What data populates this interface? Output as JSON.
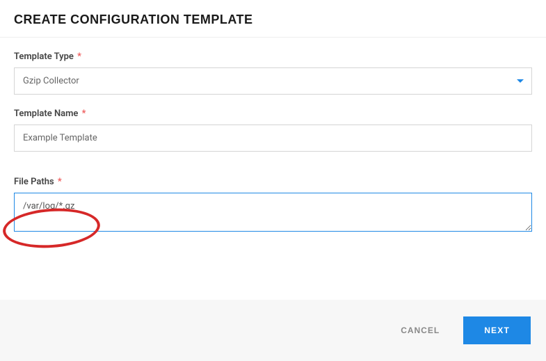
{
  "header": {
    "title": "CREATE CONFIGURATION TEMPLATE"
  },
  "form": {
    "template_type": {
      "label": "Template Type",
      "required_mark": "*",
      "value": "Gzip Collector"
    },
    "template_name": {
      "label": "Template Name",
      "required_mark": "*",
      "value": "Example Template"
    },
    "file_paths": {
      "label": "File Paths",
      "required_mark": "*",
      "value": "/var/log/*.gz"
    }
  },
  "footer": {
    "cancel_label": "CANCEL",
    "next_label": "NEXT"
  }
}
